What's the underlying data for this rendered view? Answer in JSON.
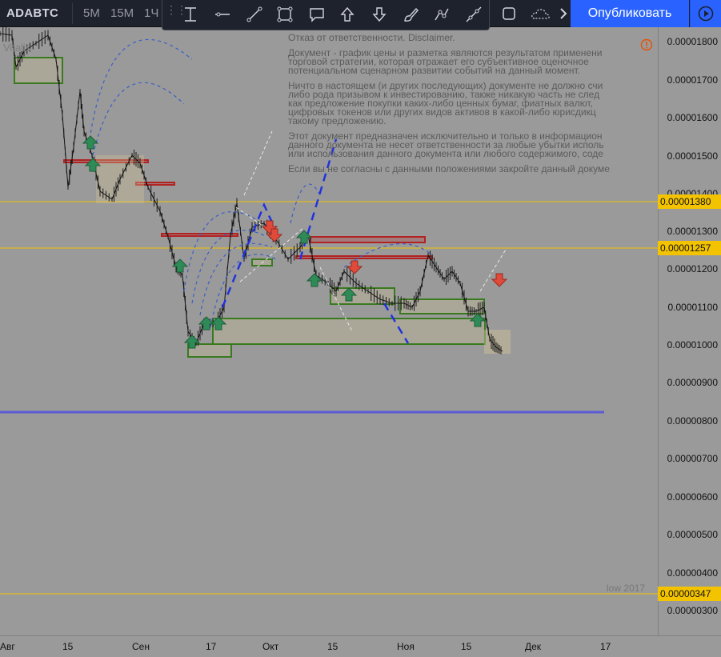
{
  "header": {
    "symbol": "ADABTC",
    "timeframes": [
      "5М",
      "15М",
      "1Ч"
    ],
    "publish_label": "Опубликовать"
  },
  "chart_meta": {
    "watermark": "Vitalis",
    "disclaimer": [
      "Отказ от ответственности. Disclaimer.",
      "Документ - график цены и разметка являются результатом применени\nторговой стратегии, которая отражает его субъективное оценочное\nпотенциальном сценарном развитии событий на данный момент.",
      "Ничто в настоящем (и других последующих) документе не должно счи\nлибо рода призывом к инвестированию, также никакую часть не след\nкак предложение покупки каких-либо ценных бумаг, фиатных валют,\nцифровых токенов или других видов активов в какой-либо юрисдикц\nтакому предложению.",
      "Этот документ предназначен исключительно и только в информацион\nданного документа не несет ответственности за любые убытки исполь\nили использования данного документа или любого содержимого, соде",
      "Если вы не согласны с данными положениями закройте данный докуме"
    ],
    "low_label": "low 2017"
  },
  "price_axis": {
    "labels": [
      "0.00001800",
      "0.00001700",
      "0.00001600",
      "0.00001500",
      "0.00001400",
      "0.00001300",
      "0.00001200",
      "0.00001100",
      "0.00001000",
      "0.00000900",
      "0.00000800",
      "0.00000700",
      "0.00000600",
      "0.00000500",
      "0.00000400",
      "0.00000300"
    ],
    "tags": [
      "0.00001380",
      "0.00001257",
      "0.00000347"
    ]
  },
  "time_axis": {
    "labels": [
      "Авг",
      "15",
      "Сен",
      "17",
      "Окт",
      "15",
      "Ноя",
      "15",
      "Дек",
      "17"
    ]
  },
  "colors": {
    "background": "#9a9a9a",
    "toolbar": "#1e222d",
    "accent": "#2962ff",
    "level_line": "#f3c300",
    "support_zone": "#3a7a1f",
    "resistance_zone": "#b22222",
    "blue_line": "#5b5bd6"
  }
}
